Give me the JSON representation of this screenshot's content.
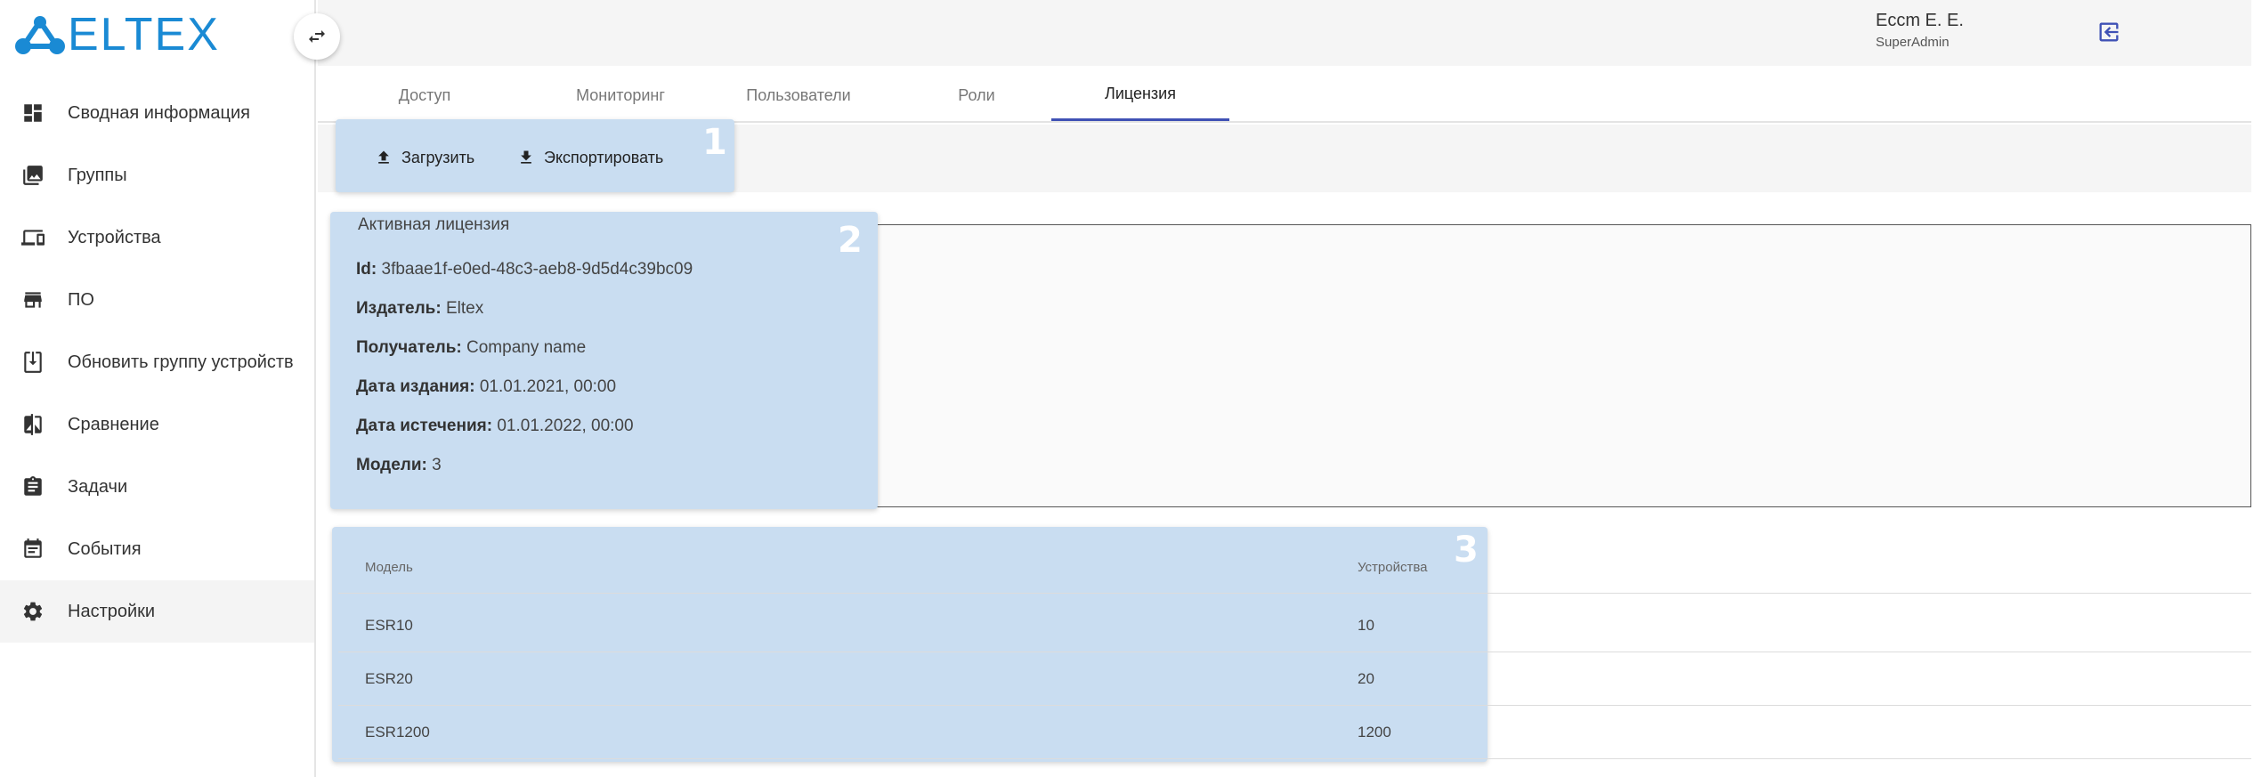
{
  "brand": {
    "logo_text": "ELTEX"
  },
  "sidebar": {
    "items": [
      {
        "label": "Сводная информация",
        "icon": "dashboard-icon"
      },
      {
        "label": "Группы",
        "icon": "photo-library-icon"
      },
      {
        "label": "Устройства",
        "icon": "devices-icon"
      },
      {
        "label": "ПО",
        "icon": "store-icon"
      },
      {
        "label": "Обновить группу устройств",
        "icon": "system-update-icon"
      },
      {
        "label": "Сравнение",
        "icon": "compare-icon"
      },
      {
        "label": "Задачи",
        "icon": "assignment-icon"
      },
      {
        "label": "События",
        "icon": "event-icon"
      },
      {
        "label": "Настройки",
        "icon": "settings-icon",
        "active": true
      }
    ]
  },
  "user": {
    "name": "Eccm E. E.",
    "role": "SuperAdmin"
  },
  "tabs": [
    "Доступ",
    "Мониторинг",
    "Пользователи",
    "Роли",
    "Лицензия"
  ],
  "active_tab": "Лицензия",
  "toolbar": {
    "upload_label": "Загрузить",
    "export_label": "Экспортировать"
  },
  "markers": [
    "1",
    "2",
    "3"
  ],
  "license": {
    "legend": "Активная лицензия",
    "fields": [
      {
        "label": "Id:",
        "value": "3fbaae1f-e0ed-48c3-aeb8-9d5d4c39bc09"
      },
      {
        "label": "Издатель:",
        "value": "Eltex"
      },
      {
        "label": "Получатель:",
        "value": "Company name"
      },
      {
        "label": "Дата издания:",
        "value": "01.01.2021, 00:00"
      },
      {
        "label": "Дата истечения:",
        "value": "01.01.2022, 00:00"
      },
      {
        "label": "Модели:",
        "value": "3"
      }
    ]
  },
  "models_table": {
    "headers": [
      "Модель",
      "Устройства"
    ],
    "rows": [
      [
        "ESR10",
        "10"
      ],
      [
        "ESR20",
        "20"
      ],
      [
        "ESR1200",
        "1200"
      ]
    ]
  },
  "colors": {
    "brand": "#1a8ad4",
    "highlight": "#c9ddf1",
    "tab_indicator": "#3f51b5"
  }
}
